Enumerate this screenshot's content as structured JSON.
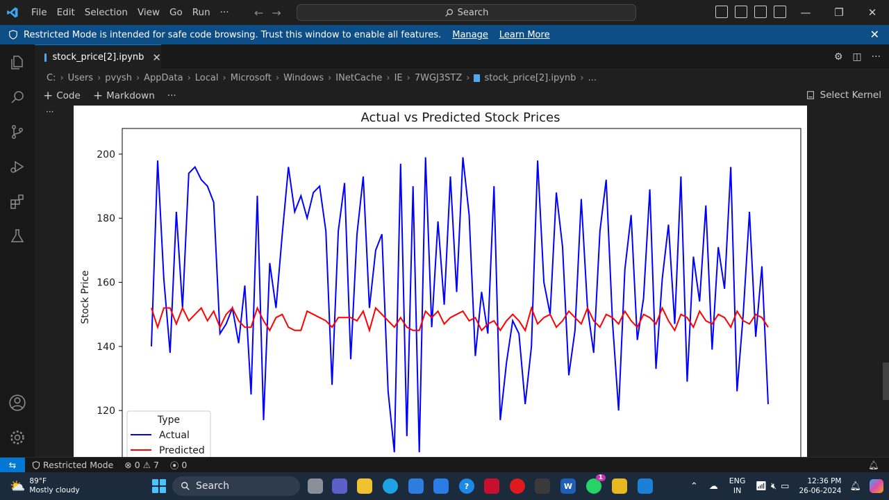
{
  "menu": [
    "File",
    "Edit",
    "Selection",
    "View",
    "Go",
    "Run",
    "···"
  ],
  "search": {
    "label": "Search"
  },
  "restricted": {
    "message": "Restricted Mode is intended for safe code browsing. Trust this window to enable all features.",
    "manage": "Manage",
    "learn_more": "Learn More"
  },
  "tab": {
    "label": "stock_price[2].ipynb"
  },
  "breadcrumb": [
    "C:",
    "Users",
    "pvysh",
    "AppData",
    "Local",
    "Microsoft",
    "Windows",
    "INetCache",
    "IE",
    "7WGJ3STZ",
    "stock_price[2].ipynb",
    "..."
  ],
  "toolbar": {
    "code": "Code",
    "markdown": "Markdown",
    "more": "···",
    "select_kernel": "Select Kernel"
  },
  "cell": {
    "dots": "···"
  },
  "chart_data": {
    "type": "line",
    "title": "Actual vs Predicted Stock Prices",
    "xlabel": "",
    "ylabel": "Stock Price",
    "ylim": [
      104,
      208
    ],
    "yticks": [
      120,
      140,
      160,
      180,
      200
    ],
    "legend": {
      "title": "Type",
      "placement": "lower-left"
    },
    "x": [
      0,
      1,
      2,
      3,
      4,
      5,
      6,
      7,
      8,
      9,
      10,
      11,
      12,
      13,
      14,
      15,
      16,
      17,
      18,
      19,
      20,
      21,
      22,
      23,
      24,
      25,
      26,
      27,
      28,
      29,
      30,
      31,
      32,
      33,
      34,
      35,
      36,
      37,
      38,
      39,
      40,
      41,
      42,
      43,
      44,
      45,
      46,
      47,
      48,
      49,
      50,
      51,
      52,
      53,
      54,
      55,
      56,
      57,
      58,
      59,
      60,
      61,
      62,
      63,
      64,
      65,
      66,
      67,
      68,
      69,
      70,
      71,
      72,
      73,
      74,
      75,
      76,
      77,
      78,
      79,
      80,
      81,
      82,
      83,
      84,
      85,
      86,
      87,
      88,
      89,
      90,
      91,
      92,
      93,
      94,
      95,
      96,
      97,
      98,
      99
    ],
    "series": [
      {
        "name": "Actual",
        "color": "#0000ff",
        "values": [
          140,
          198,
          161,
          138,
          182,
          152,
          194,
          196,
          192,
          190,
          185,
          144,
          147,
          152,
          141,
          159,
          125,
          187,
          117,
          166,
          152,
          175,
          196,
          182,
          187,
          180,
          188,
          190,
          176,
          128,
          176,
          191,
          136,
          175,
          193,
          152,
          170,
          175,
          126,
          107,
          197,
          112,
          190,
          107,
          199,
          146,
          179,
          153,
          193,
          157,
          199,
          181,
          137,
          157,
          144,
          190,
          117,
          135,
          148,
          144,
          122,
          140,
          198,
          160,
          150,
          188,
          171,
          131,
          145,
          186,
          152,
          138,
          176,
          192,
          148,
          120,
          164,
          181,
          142,
          155,
          189,
          133,
          161,
          178,
          147,
          193,
          129,
          168,
          154,
          184,
          139,
          171,
          158,
          196,
          126,
          150,
          182,
          143,
          165,
          122
        ]
      },
      {
        "name": "Predicted",
        "color": "#ff0000",
        "values": [
          152,
          146,
          152,
          152,
          147,
          152,
          148,
          150,
          152,
          148,
          151,
          146,
          150,
          152,
          148,
          146,
          146,
          152,
          148,
          145,
          149,
          150,
          146,
          145,
          145,
          151,
          150,
          149,
          148,
          146,
          149,
          149,
          149,
          148,
          151,
          145,
          152,
          150,
          148,
          146,
          149,
          146,
          145,
          145,
          151,
          149,
          151,
          147,
          149,
          150,
          151,
          148,
          149,
          145,
          147,
          148,
          145,
          148,
          150,
          148,
          145,
          152,
          147,
          149,
          150,
          146,
          148,
          151,
          149,
          147,
          152,
          148,
          146,
          150,
          149,
          147,
          151,
          148,
          146,
          150,
          149,
          147,
          152,
          148,
          145,
          150,
          149,
          146,
          151,
          148,
          147,
          150,
          149,
          146,
          151,
          148,
          147,
          150,
          149,
          146
        ]
      }
    ]
  },
  "status": {
    "restricted": "Restricted Mode",
    "errors": "0",
    "warnings": "7",
    "ports": "0"
  },
  "taskbar": {
    "temp": "89°F",
    "weather": "Mostly cloudy",
    "search": "Search",
    "lang1": "ENG",
    "lang2": "IN",
    "time": "12:36 PM",
    "date": "26-06-2024",
    "whatsapp_badge": "1"
  }
}
